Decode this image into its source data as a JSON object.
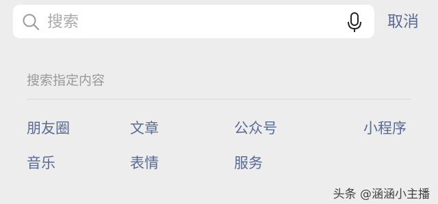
{
  "search": {
    "placeholder": "搜索",
    "cancel_label": "取消"
  },
  "section": {
    "title": "搜索指定内容"
  },
  "categories": [
    {
      "label": "朋友圈"
    },
    {
      "label": "文章"
    },
    {
      "label": "公众号"
    },
    {
      "label": "小程序"
    },
    {
      "label": "音乐"
    },
    {
      "label": "表情"
    },
    {
      "label": "服务"
    }
  ],
  "watermark": {
    "text": "头条 @涵涵小主播"
  },
  "colors": {
    "background": "#ededed",
    "link": "#576b95",
    "muted": "#999999"
  }
}
